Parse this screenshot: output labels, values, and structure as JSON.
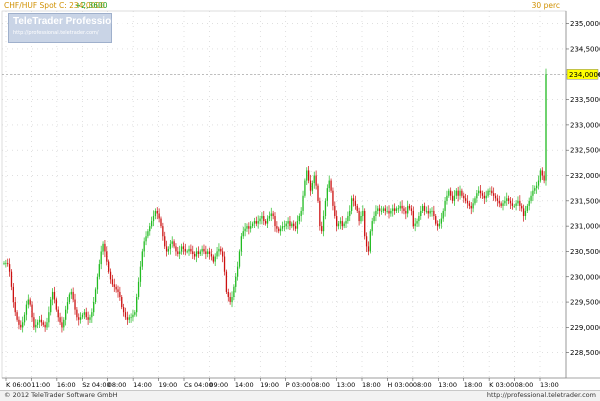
{
  "header": {
    "symbol": "CHF/HUF Spot",
    "quote": "C: 234,0000",
    "change": "+2,3600",
    "period": "30 perc"
  },
  "logo": {
    "name": "TeleTrader Professional",
    "url": "http://professional.teletrader.com/"
  },
  "footer": {
    "copyright": "© 2012 TeleTrader Software GmbH",
    "url": "http://professional.teletrader.com"
  },
  "colors": {
    "up": "#22bb22",
    "down": "#cc1111",
    "grid": "#cccccc",
    "axis_label": "#000000",
    "last_price_box": "#ffff00"
  },
  "chart_data": {
    "type": "candlestick",
    "title": "CHF/HUF Spot",
    "interval": "30 perc",
    "ylim": [
      228.0,
      235.25
    ],
    "y_ticks": [
      "228,5000",
      "229,0000",
      "229,5000",
      "230,0000",
      "230,5000",
      "231,0000",
      "231,5000",
      "232,0000",
      "232,5000",
      "233,0000",
      "233,5000",
      "234,0000",
      "234,5000",
      "235,0000"
    ],
    "last_price": 234.0,
    "last_price_label": "234,0000",
    "x_labels": [
      "K 06:00",
      "11:00",
      "16:00",
      "Sz 04:00",
      "08:00",
      "14:00",
      "19:00",
      "Cs 04:00",
      "09:00",
      "14:00",
      "19:00",
      "P 03:00",
      "08:00",
      "13:00",
      "18:00",
      "H 03:00",
      "08:00",
      "13:00",
      "18:00",
      "K 03:00",
      "08:00",
      "13:00"
    ],
    "closes": [
      230.27,
      230.27,
      230.25,
      230.1,
      229.8,
      229.5,
      229.3,
      229.15,
      229.05,
      229.0,
      229.1,
      229.25,
      229.45,
      229.55,
      229.45,
      229.2,
      229.0,
      229.05,
      229.1,
      229.15,
      229.1,
      229.05,
      229.0,
      229.1,
      229.3,
      229.55,
      229.7,
      229.55,
      229.35,
      229.2,
      229.1,
      229.0,
      229.15,
      229.35,
      229.5,
      229.65,
      229.7,
      229.55,
      229.35,
      229.2,
      229.15,
      229.2,
      229.25,
      229.3,
      229.2,
      229.15,
      229.2,
      229.3,
      229.5,
      229.75,
      230.0,
      230.25,
      230.5,
      230.65,
      230.5,
      230.3,
      230.1,
      229.95,
      229.85,
      229.8,
      229.75,
      229.7,
      229.6,
      229.4,
      229.3,
      229.2,
      229.15,
      229.2,
      229.2,
      229.25,
      229.3,
      229.6,
      229.9,
      230.2,
      230.5,
      230.7,
      230.8,
      230.9,
      231.0,
      231.1,
      231.2,
      231.3,
      231.25,
      231.15,
      231.0,
      230.8,
      230.6,
      230.5,
      230.55,
      230.65,
      230.7,
      230.6,
      230.5,
      230.45,
      230.5,
      230.6,
      230.55,
      230.5,
      230.5,
      230.55,
      230.5,
      230.45,
      230.4,
      230.5,
      230.45,
      230.5,
      230.55,
      230.5,
      230.45,
      230.5,
      230.45,
      230.4,
      230.3,
      230.4,
      230.5,
      230.55,
      230.5,
      230.4,
      230.1,
      229.7,
      229.6,
      229.5,
      229.6,
      229.8,
      230.0,
      230.2,
      230.5,
      230.8,
      230.9,
      230.95,
      231.0,
      230.95,
      231.0,
      231.05,
      231.1,
      231.05,
      231.1,
      231.15,
      231.2,
      231.1,
      231.05,
      231.15,
      231.2,
      231.25,
      231.2,
      231.0,
      230.95,
      230.9,
      230.95,
      231.0,
      231.0,
      231.05,
      231.1,
      231.0,
      231.05,
      231.0,
      230.95,
      231.1,
      231.2,
      231.3,
      231.6,
      231.9,
      232.1,
      231.9,
      231.7,
      231.85,
      232.0,
      231.8,
      231.5,
      231.0,
      230.9,
      231.2,
      231.5,
      231.75,
      231.9,
      231.7,
      231.4,
      231.2,
      231.0,
      231.05,
      231.1,
      231.0,
      231.05,
      231.1,
      231.2,
      231.3,
      231.55,
      231.5,
      231.4,
      231.3,
      231.1,
      231.2,
      231.3,
      230.8,
      230.6,
      230.5,
      230.9,
      231.1,
      231.2,
      231.3,
      231.35,
      231.3,
      231.3,
      231.35,
      231.3,
      231.3,
      231.25,
      231.3,
      231.35,
      231.3,
      231.35,
      231.35,
      231.4,
      231.35,
      231.3,
      231.25,
      231.4,
      231.35,
      231.3,
      231.0,
      231.05,
      231.1,
      231.2,
      231.3,
      231.4,
      231.3,
      231.3,
      231.25,
      231.3,
      231.3,
      231.2,
      231.05,
      231.0,
      231.05,
      231.15,
      231.3,
      231.5,
      231.6,
      231.7,
      231.6,
      231.5,
      231.6,
      231.7,
      231.6,
      231.7,
      231.6,
      231.55,
      231.5,
      231.45,
      231.4,
      231.35,
      231.45,
      231.55,
      231.65,
      231.7,
      231.65,
      231.6,
      231.55,
      231.6,
      231.7,
      231.7,
      231.65,
      231.6,
      231.55,
      231.5,
      231.45,
      231.4,
      231.45,
      231.5,
      231.55,
      231.5,
      231.45,
      231.4,
      231.4,
      231.45,
      231.5,
      231.4,
      231.35,
      231.2,
      231.3,
      231.4,
      231.5,
      231.6,
      231.7,
      231.75,
      231.8,
      231.9,
      232.1,
      232.0,
      231.9,
      234.0
    ]
  }
}
